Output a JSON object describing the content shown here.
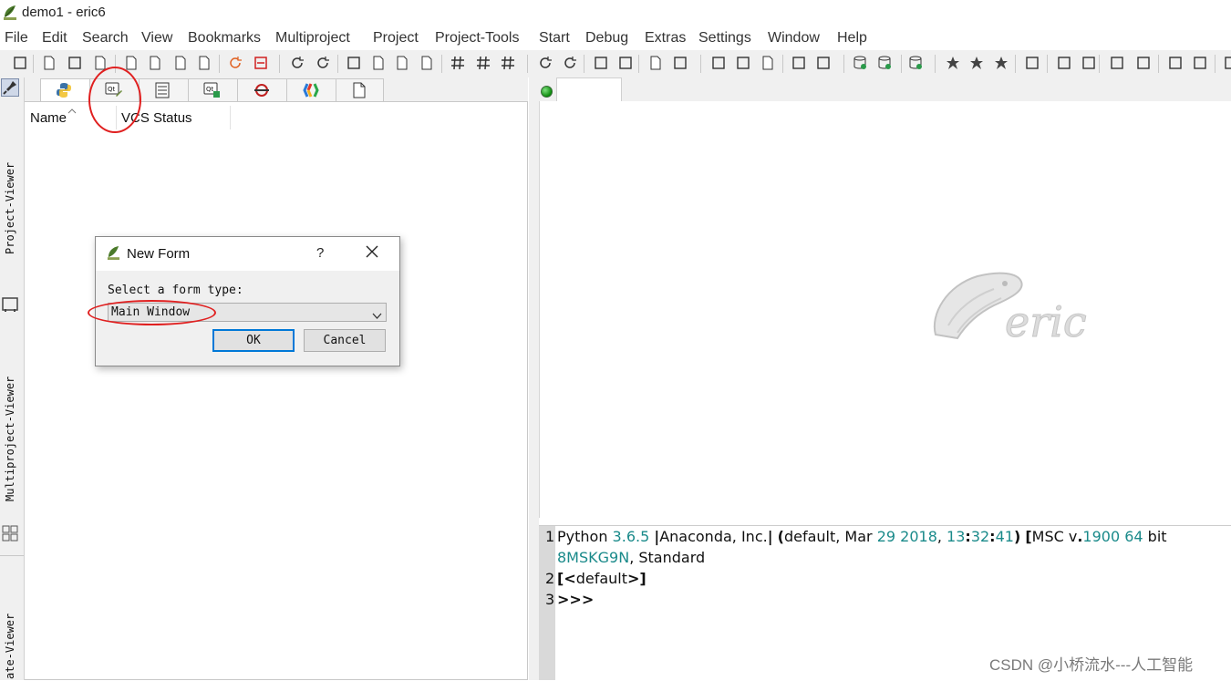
{
  "window": {
    "title": "demo1 - eric6"
  },
  "menubar": {
    "items": [
      "File",
      "Edit",
      "Search",
      "View",
      "Bookmarks",
      "Multiproject",
      "Project",
      "Project-Tools",
      "Start",
      "Debug",
      "Extras",
      "Settings",
      "Window",
      "Help"
    ]
  },
  "sidebar": {
    "labels": [
      "Project-Viewer",
      "Multiproject-Viewer",
      "ate-Viewer"
    ]
  },
  "project_viewer": {
    "columns": [
      "Name",
      "VCS Status"
    ]
  },
  "dialog": {
    "title": "New Form",
    "help": "?",
    "prompt": "Select a form type:",
    "form_type": "Main Window",
    "ok_label": "OK",
    "cancel_label": "Cancel"
  },
  "shell": {
    "lines": [
      {
        "no": "1",
        "parts": [
          {
            "t": "Python "
          },
          {
            "t": "3.6.5",
            "c": "num"
          },
          {
            "t": " "
          },
          {
            "t": "|",
            "c": "bold"
          },
          {
            "t": "Anaconda, Inc."
          },
          {
            "t": "|",
            "c": "bold"
          },
          {
            "t": " "
          },
          {
            "t": "(",
            "c": "bold"
          },
          {
            "t": "default, Mar "
          },
          {
            "t": "29",
            "c": "num"
          },
          {
            "t": " "
          },
          {
            "t": "2018",
            "c": "num"
          },
          {
            "t": ", "
          },
          {
            "t": "13",
            "c": "num"
          },
          {
            "t": ":",
            "c": "bold"
          },
          {
            "t": "32",
            "c": "num"
          },
          {
            "t": ":",
            "c": "bold"
          },
          {
            "t": "41",
            "c": "num"
          },
          {
            "t": ")",
            "c": "bold"
          },
          {
            "t": " "
          },
          {
            "t": "[",
            "c": "bold"
          },
          {
            "t": "MSC v"
          },
          {
            "t": ".",
            "c": "bold"
          },
          {
            "t": "1900",
            "c": "num"
          },
          {
            "t": " "
          },
          {
            "t": "64",
            "c": "num"
          },
          {
            "t": " bit"
          }
        ]
      },
      {
        "no": "",
        "parts": [
          {
            "t": "8MSKG9N",
            "c": "num"
          },
          {
            "t": ", Standard"
          }
        ]
      },
      {
        "no": "2",
        "parts": [
          {
            "t": "[<",
            "c": "bold"
          },
          {
            "t": "default"
          },
          {
            "t": ">]",
            "c": "bold"
          }
        ]
      },
      {
        "no": "3",
        "parts": [
          {
            "t": ">>>",
            "c": "bold"
          }
        ]
      }
    ]
  },
  "watermark": "CSDN @小桥流水---人工智能",
  "colors": {
    "annotation": "#e02020",
    "number": "#1a8a8a",
    "focus": "#0078d7"
  }
}
